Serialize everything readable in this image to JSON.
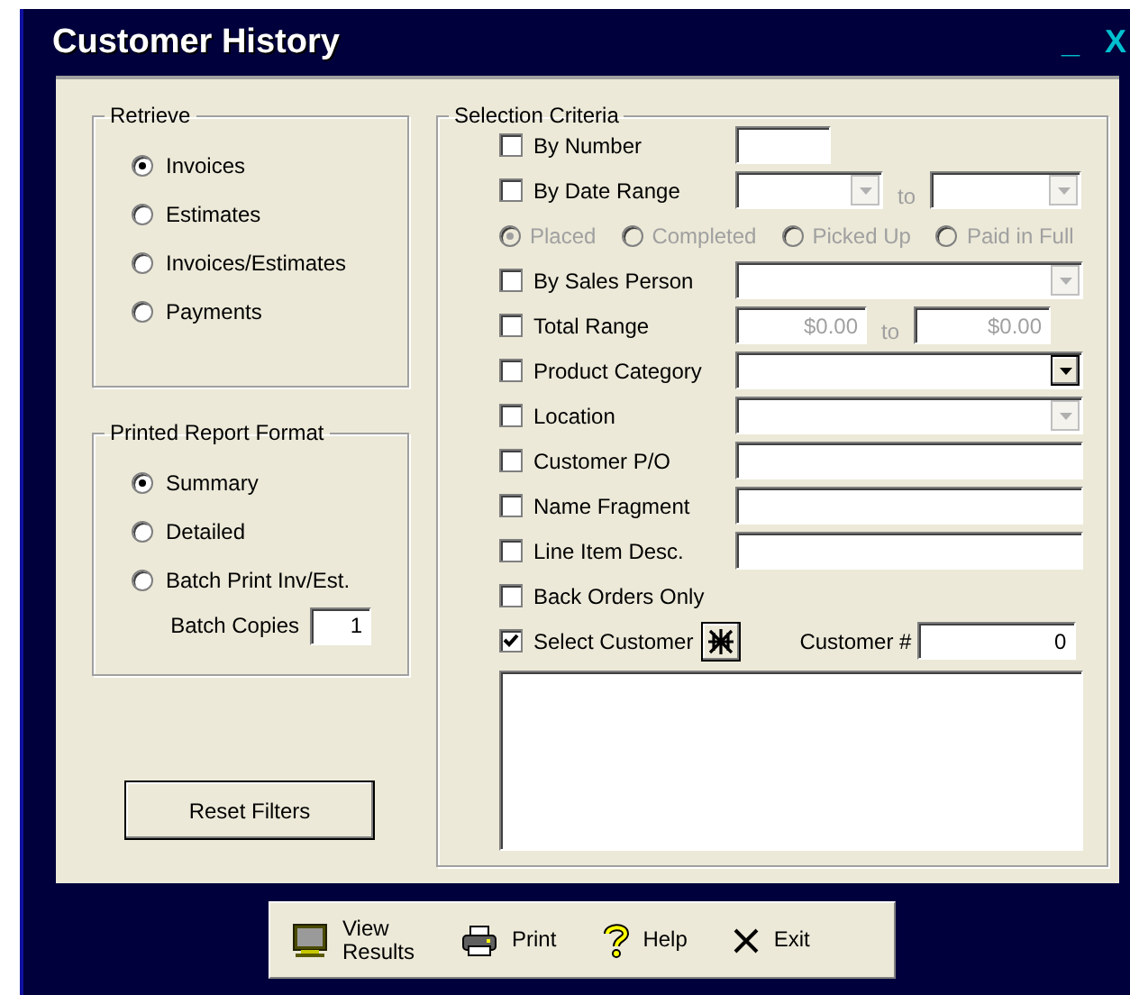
{
  "window": {
    "title": "Customer History",
    "controls": [
      "_",
      "X"
    ]
  },
  "retrieve": {
    "title": "Retrieve",
    "options": [
      {
        "label": "Invoices",
        "selected": true
      },
      {
        "label": "Estimates",
        "selected": false
      },
      {
        "label": "Invoices/Estimates",
        "selected": false
      },
      {
        "label": "Payments",
        "selected": false
      }
    ]
  },
  "report_format": {
    "title": "Printed Report Format",
    "options": [
      {
        "label": "Summary",
        "selected": true
      },
      {
        "label": "Detailed",
        "selected": false
      },
      {
        "label": "Batch Print Inv/Est.",
        "selected": false
      }
    ],
    "batch_copies": {
      "label": "Batch Copies",
      "value": "1"
    }
  },
  "reset_button": "Reset Filters",
  "criteria": {
    "title": "Selection Criteria",
    "rows": [
      {
        "kind": "short-text",
        "label": "By Number",
        "checked": false
      },
      {
        "kind": "date-range",
        "label": "By Date Range",
        "checked": false,
        "separator": "to",
        "disabled": true
      },
      {
        "kind": "radios",
        "disabled": true,
        "options": [
          {
            "label": "Placed",
            "selected": true
          },
          {
            "label": "Completed",
            "selected": false
          },
          {
            "label": "Picked Up",
            "selected": false
          },
          {
            "label": "Paid in Full",
            "selected": false
          }
        ]
      },
      {
        "kind": "combo",
        "label": "By Sales Person",
        "checked": false,
        "disabled": true
      },
      {
        "kind": "amount-range",
        "label": "Total Range",
        "checked": false,
        "from": "$0.00",
        "separator": "to",
        "to": "$0.00",
        "disabled": true
      },
      {
        "kind": "combo",
        "label": "Product Category",
        "checked": false,
        "disabled": false
      },
      {
        "kind": "combo",
        "label": "Location",
        "checked": false,
        "disabled": true
      },
      {
        "kind": "text",
        "label": "Customer P/O",
        "checked": false
      },
      {
        "kind": "text",
        "label": "Name Fragment",
        "checked": false
      },
      {
        "kind": "text",
        "label": "Line Item Desc.",
        "checked": false
      },
      {
        "kind": "plain",
        "label": "Back Orders Only",
        "checked": false
      },
      {
        "kind": "customer",
        "label": "Select Customer",
        "checked": true,
        "number_label": "Customer #",
        "number": "0"
      },
      {
        "kind": "list"
      }
    ]
  },
  "toolbar": [
    {
      "kind": "view",
      "label": "View Results"
    },
    {
      "kind": "print",
      "label": "Print"
    },
    {
      "kind": "help",
      "label": "Help"
    },
    {
      "kind": "exit",
      "label": "Exit"
    }
  ]
}
